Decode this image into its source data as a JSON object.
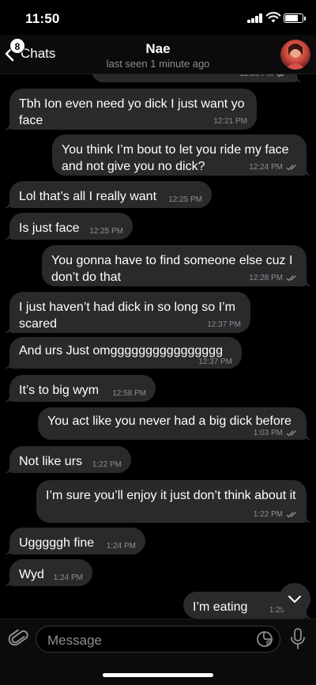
{
  "status_bar": {
    "time": "11:50"
  },
  "header": {
    "back_label": "Chats",
    "unread_count": "8",
    "contact_name": "Nae",
    "last_seen": "last seen 1 minute ago"
  },
  "messages": [
    {
      "direction": "out",
      "text": "",
      "time": "12:20 PM",
      "partial": true
    },
    {
      "direction": "in",
      "text": "Tbh Ion even need yo dick I just want yo face",
      "time": "12:21 PM"
    },
    {
      "direction": "out",
      "text": "You think I’m bout to let you ride my face and not give you no dick?",
      "time": "12:24 PM",
      "read": true
    },
    {
      "direction": "in",
      "text": "Lol that’s all I really want",
      "time": "12:25 PM"
    },
    {
      "direction": "in",
      "text": "Is just face",
      "time": "12:25 PM"
    },
    {
      "direction": "out",
      "text": "You gonna have to find someone else cuz I don’t do that",
      "time": "12:28 PM",
      "read": true
    },
    {
      "direction": "in",
      "text": "I just haven’t had dick in so long so I’m scared",
      "time": "12:37 PM"
    },
    {
      "direction": "in",
      "text": "And urs Just omgggggggggggggggg",
      "time": "12:37 PM"
    },
    {
      "direction": "in",
      "text": "It’s to big wym",
      "time": "12:58 PM"
    },
    {
      "direction": "out",
      "text": "You act like you never had a big dick before",
      "time": "1:03 PM",
      "read": true
    },
    {
      "direction": "in",
      "text": "Not like urs",
      "time": "1:22 PM"
    },
    {
      "direction": "out",
      "text": "I’m sure you’ll enjoy it just don’t think about it",
      "time": "1:22 PM",
      "read": true
    },
    {
      "direction": "in",
      "text": "Ugggggh fine",
      "time": "1:24 PM"
    },
    {
      "direction": "in",
      "text": "Wyd",
      "time": "1:24 PM"
    },
    {
      "direction": "out",
      "text": "I’m eating",
      "time": "1:25 PM",
      "read": true
    }
  ],
  "composer": {
    "placeholder": "Message"
  },
  "icons": {
    "back": "chevron-left-icon",
    "attach": "paperclip-icon",
    "sticker": "sticker-icon",
    "mic": "microphone-icon",
    "scroll_down": "chevron-down-icon",
    "read_receipt": "double-check-icon"
  },
  "colors": {
    "bubble": "#2a2a2c",
    "background": "#000000",
    "secondary_text": "#8e8e93"
  }
}
